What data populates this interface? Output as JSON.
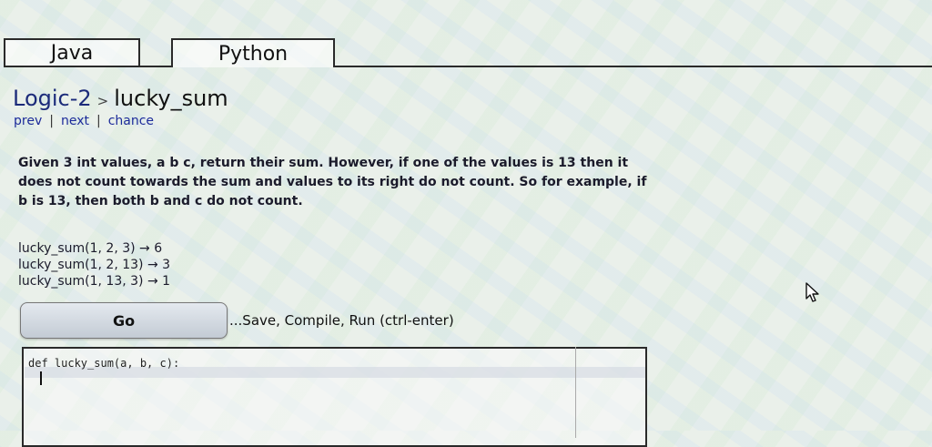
{
  "tabs": [
    {
      "label": "Java",
      "active": false
    },
    {
      "label": "Python",
      "active": true
    }
  ],
  "breadcrumb": {
    "category": "Logic-2",
    "separator": ">",
    "problem": "lucky_sum"
  },
  "nav": {
    "prev": "prev",
    "separator": "|",
    "next": "next",
    "chance": "chance"
  },
  "description": "Given 3 int values, a b c, return their sum. However, if one of the values is 13 then it does not count towards the sum and values to its right do not count. So for example, if b is 13, then both b and c do not count.",
  "examples": [
    "lucky_sum(1, 2, 3) → 6",
    "lucky_sum(1, 2, 13) → 3",
    "lucky_sum(1, 13, 3) → 1"
  ],
  "actions": {
    "go_label": "Go",
    "run_hint": "...Save, Compile, Run (ctrl-enter)"
  },
  "editor": {
    "code": "def lucky_sum(a, b, c):"
  },
  "colors": {
    "link": "#1c2b9a",
    "title": "#1c2b7a"
  }
}
